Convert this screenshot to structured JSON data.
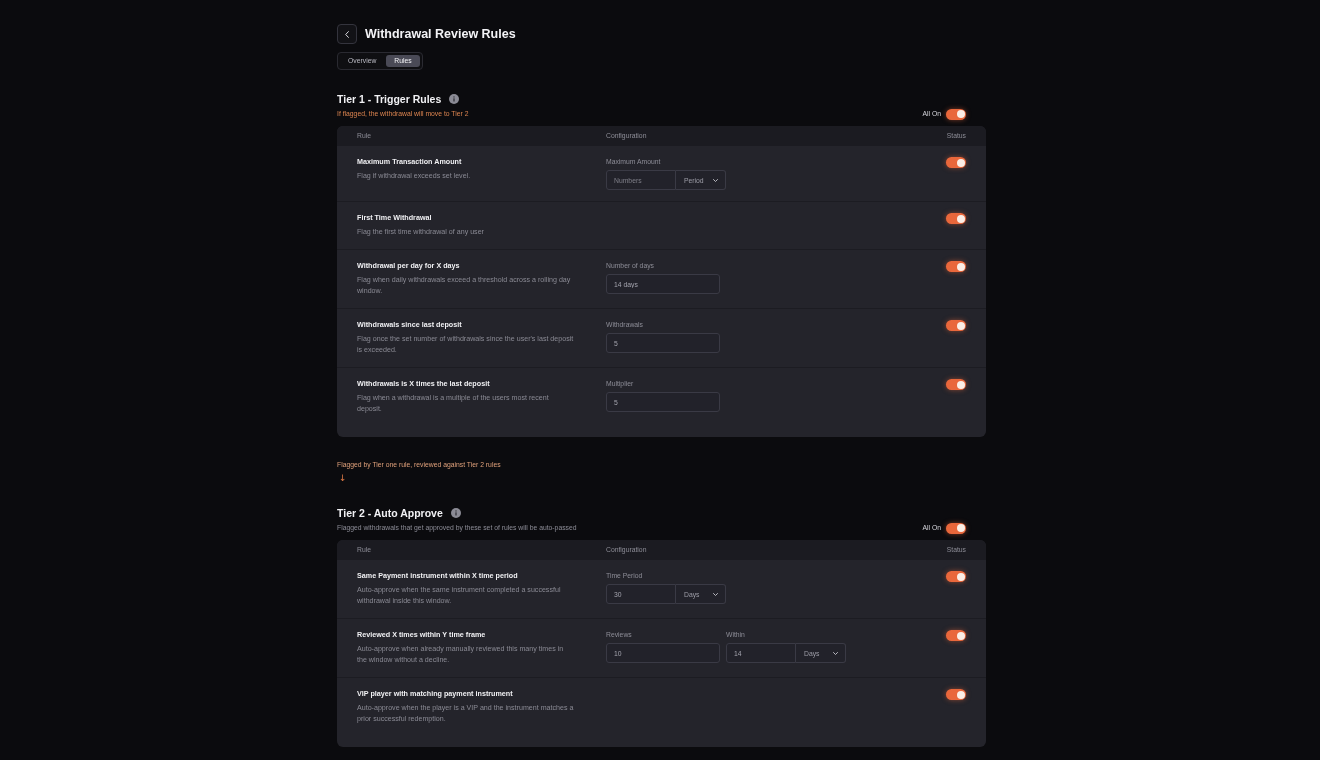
{
  "header": {
    "title": "Withdrawal Review Rules"
  },
  "tabs": [
    {
      "label": "Overview",
      "selected": false
    },
    {
      "label": "Rules",
      "selected": true
    }
  ],
  "sections": [
    {
      "kind": "tier",
      "title": "Tier 1 - Trigger Rules",
      "subtitle": {
        "text": "If flagged, the withdrawal will move to Tier 2",
        "warning": true
      },
      "master_toggle": {
        "label": "All On",
        "on": true
      },
      "columns": [
        "Rule",
        "Configuration",
        "Status"
      ],
      "rules": [
        {
          "title": "Maximum Transaction Amount",
          "description": "Flag if withdrawal exceeds set level.",
          "fields": [
            {
              "kind": "input_select",
              "label": "Maximum Amount",
              "placeholder": "Numbers",
              "option": "Period"
            }
          ],
          "on": true
        },
        {
          "title": "First Time Withdrawal",
          "description": "Flag the first time withdrawal of any user",
          "on": true
        },
        {
          "title": "Withdrawal per day for X days",
          "description": "Flag when daily withdrawals exceed a threshold across a rolling day window.",
          "fields": [
            {
              "kind": "input",
              "label": "Number of days",
              "value": "14 days"
            }
          ],
          "on": true
        },
        {
          "title": "Withdrawals since last deposit",
          "description": "Flag once the set number of withdrawals since the user's last deposit is exceeded.",
          "fields": [
            {
              "kind": "input",
              "label": "Withdrawals",
              "value": "5"
            }
          ],
          "on": true
        },
        {
          "title": "Withdrawals is X times the last deposit",
          "description": "Flag when a withdrawal is a multiple of the users most recent deposit.",
          "fields": [
            {
              "kind": "input",
              "label": "Multiplier",
              "value": "5"
            }
          ],
          "on": true
        }
      ]
    },
    {
      "kind": "note",
      "text": "Flagged by Tier one rule, reviewed against Tier 2 rules",
      "arrow": "↓"
    },
    {
      "kind": "tier",
      "title": "Tier 2 - Auto Approve",
      "subtitle": {
        "text": "Flagged withdrawals that get approved by these set of rules will be auto-passed",
        "warning": false
      },
      "master_toggle": {
        "label": "All On",
        "on": true
      },
      "columns": [
        "Rule",
        "Configuration",
        "Status"
      ],
      "rules": [
        {
          "title": "Same Payment instrument within X time period",
          "description": "Auto-approve when the same instrument completed a successful withdrawal inside this window.",
          "fields": [
            {
              "kind": "input_select",
              "label": "Time Period",
              "value": "30",
              "option": "Days"
            }
          ],
          "on": true
        },
        {
          "title": "Reviewed X times within Y time frame",
          "description": "Auto-approve when already manually reviewed this many times in the window without a decline.",
          "fields": [
            {
              "kind": "input",
              "label": "Reviews",
              "value": "10"
            },
            {
              "kind": "input_select",
              "label": "Within",
              "value": "14",
              "option": "Days"
            }
          ],
          "on": true
        },
        {
          "title": "VIP player with matching payment instrument",
          "description": "Auto-approve when the player is a VIP and the instrument matches a prior successful redemption.",
          "on": true
        }
      ]
    }
  ]
}
